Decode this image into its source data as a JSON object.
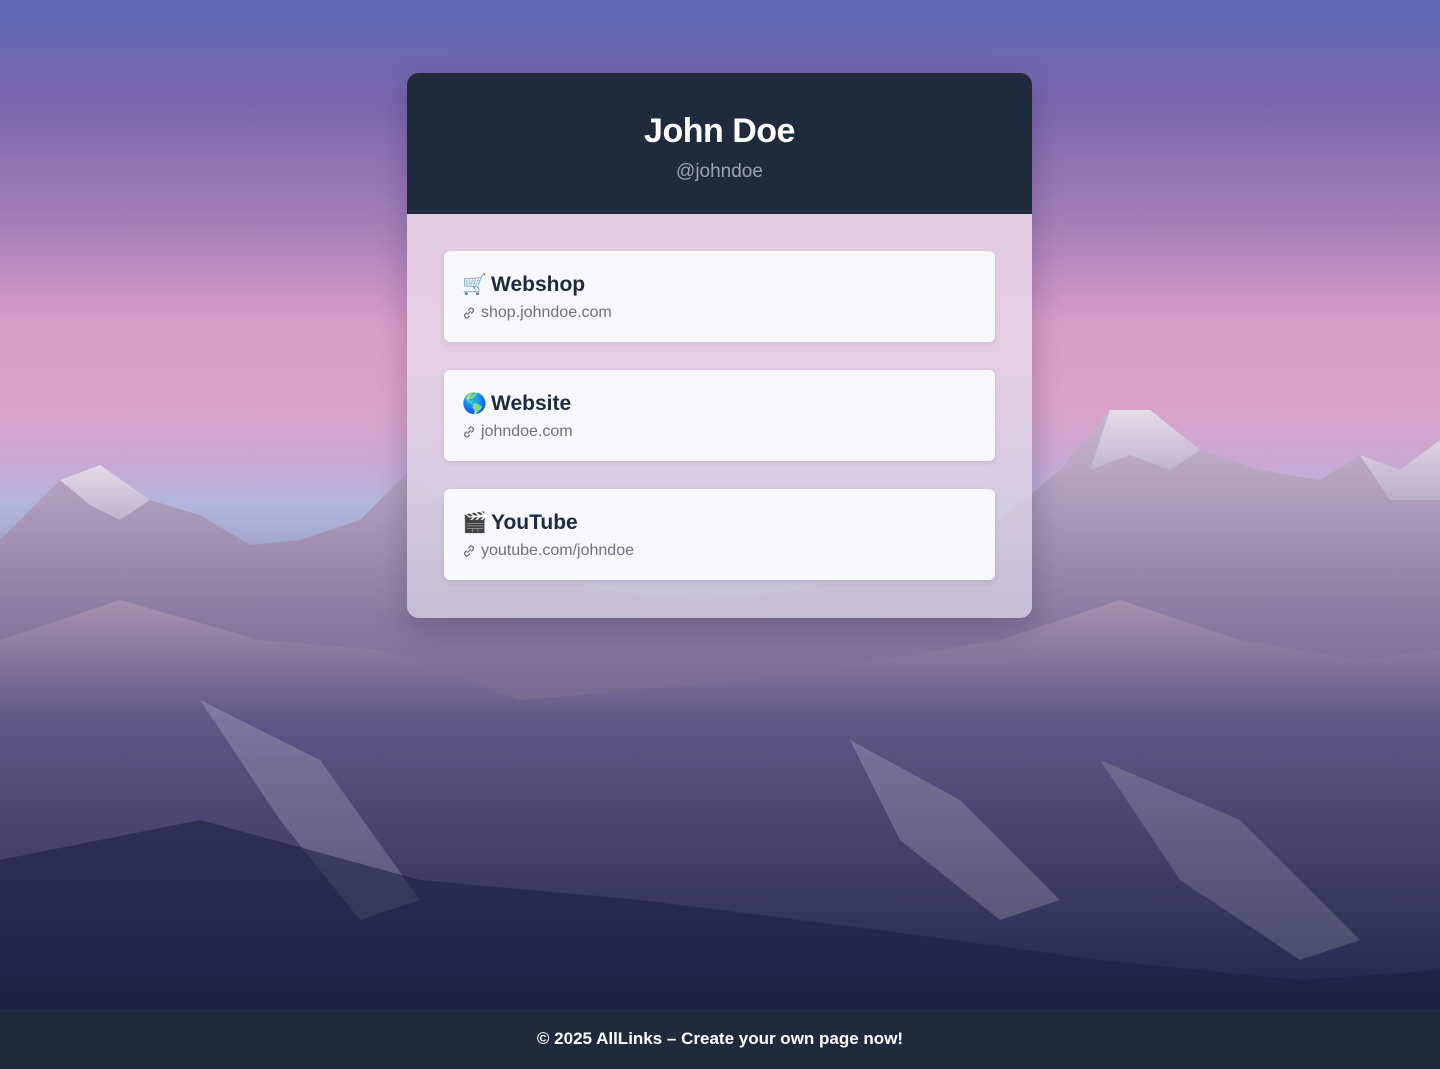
{
  "profile": {
    "name": "John Doe",
    "handle": "@johndoe"
  },
  "links": [
    {
      "icon": "shopping-cart-icon",
      "emoji": "🛒",
      "title": "Webshop",
      "url": "shop.johndoe.com"
    },
    {
      "icon": "globe-icon",
      "emoji": "🌎",
      "title": "Website",
      "url": "johndoe.com"
    },
    {
      "icon": "clapperboard-icon",
      "emoji": "🎬",
      "title": "YouTube",
      "url": "youtube.com/johndoe"
    }
  ],
  "footer": {
    "text": "© 2025 AllLinks – Create your own page now!"
  },
  "colors": {
    "header_bg": "#1f2a3c",
    "card_bg": "#f6f8fb",
    "title_text": "#1f2a3c",
    "url_text": "#6b7280"
  }
}
